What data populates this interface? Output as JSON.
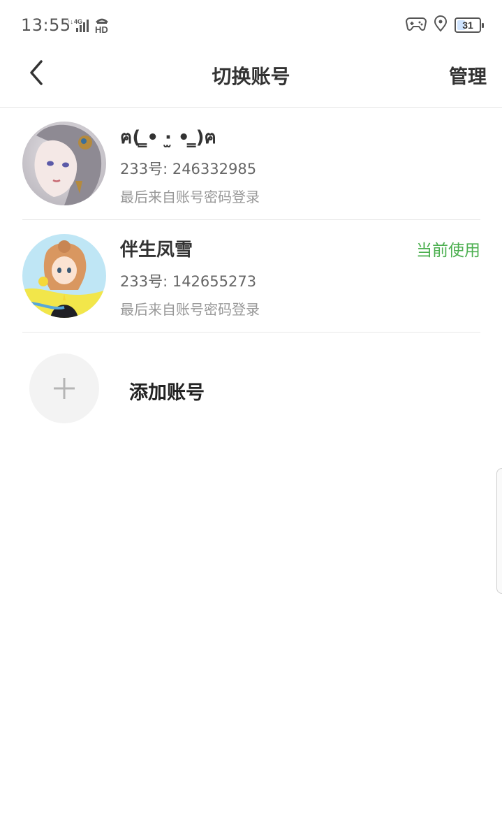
{
  "status_bar": {
    "time": "13:55",
    "network": "4G",
    "hd": "HD",
    "battery_level": "31",
    "battery_fraction": 0.31
  },
  "nav": {
    "title": "切换账号",
    "manage_label": "管理"
  },
  "accounts": [
    {
      "name": "ฅ( ̳• ·̫ • ̳)ฅ",
      "id_text": "233号: 246332985",
      "login_method": "最后来自账号密码登录",
      "current": false
    },
    {
      "name": "伴生凤雪",
      "id_text": "233号: 142655273",
      "login_method": "最后来自账号密码登录",
      "current": true,
      "current_label": "当前使用"
    }
  ],
  "add_account": {
    "label": "添加账号"
  },
  "colors": {
    "accent_green": "#4caf50",
    "divider": "#e8e8e8",
    "add_circle_bg": "#f3f3f3"
  }
}
